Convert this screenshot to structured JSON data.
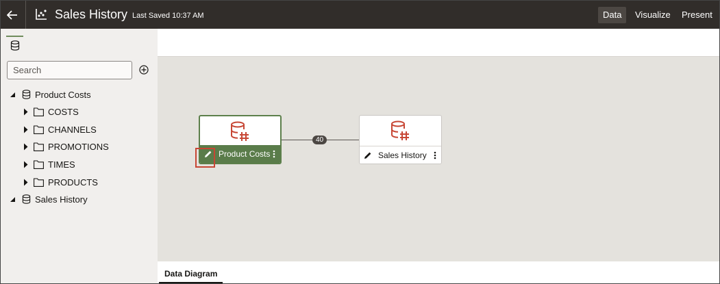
{
  "header": {
    "title": "Sales History",
    "last_saved": "Last Saved 10:37 AM",
    "nav": [
      "Data",
      "Visualize",
      "Present"
    ]
  },
  "sidebar": {
    "search_placeholder": "Search",
    "tree": [
      {
        "label": "Product Costs",
        "type": "dataset",
        "expanded": true,
        "children": [
          "COSTS",
          "CHANNELS",
          "PROMOTIONS",
          "TIMES",
          "PRODUCTS"
        ]
      },
      {
        "label": "Sales History",
        "type": "dataset",
        "expanded": true,
        "children": []
      }
    ]
  },
  "diagram": {
    "nodes": [
      {
        "label": "Product Costs",
        "selected": true
      },
      {
        "label": "Sales History",
        "selected": false
      }
    ],
    "link_count": "40"
  },
  "bottom_tabs": [
    "Data Diagram"
  ],
  "colors": {
    "header_bg": "#312d2a",
    "accent_green": "#5a7c4a",
    "icon_red": "#c74634",
    "canvas_bg": "#e4e2dd",
    "highlight": "#c74634"
  }
}
